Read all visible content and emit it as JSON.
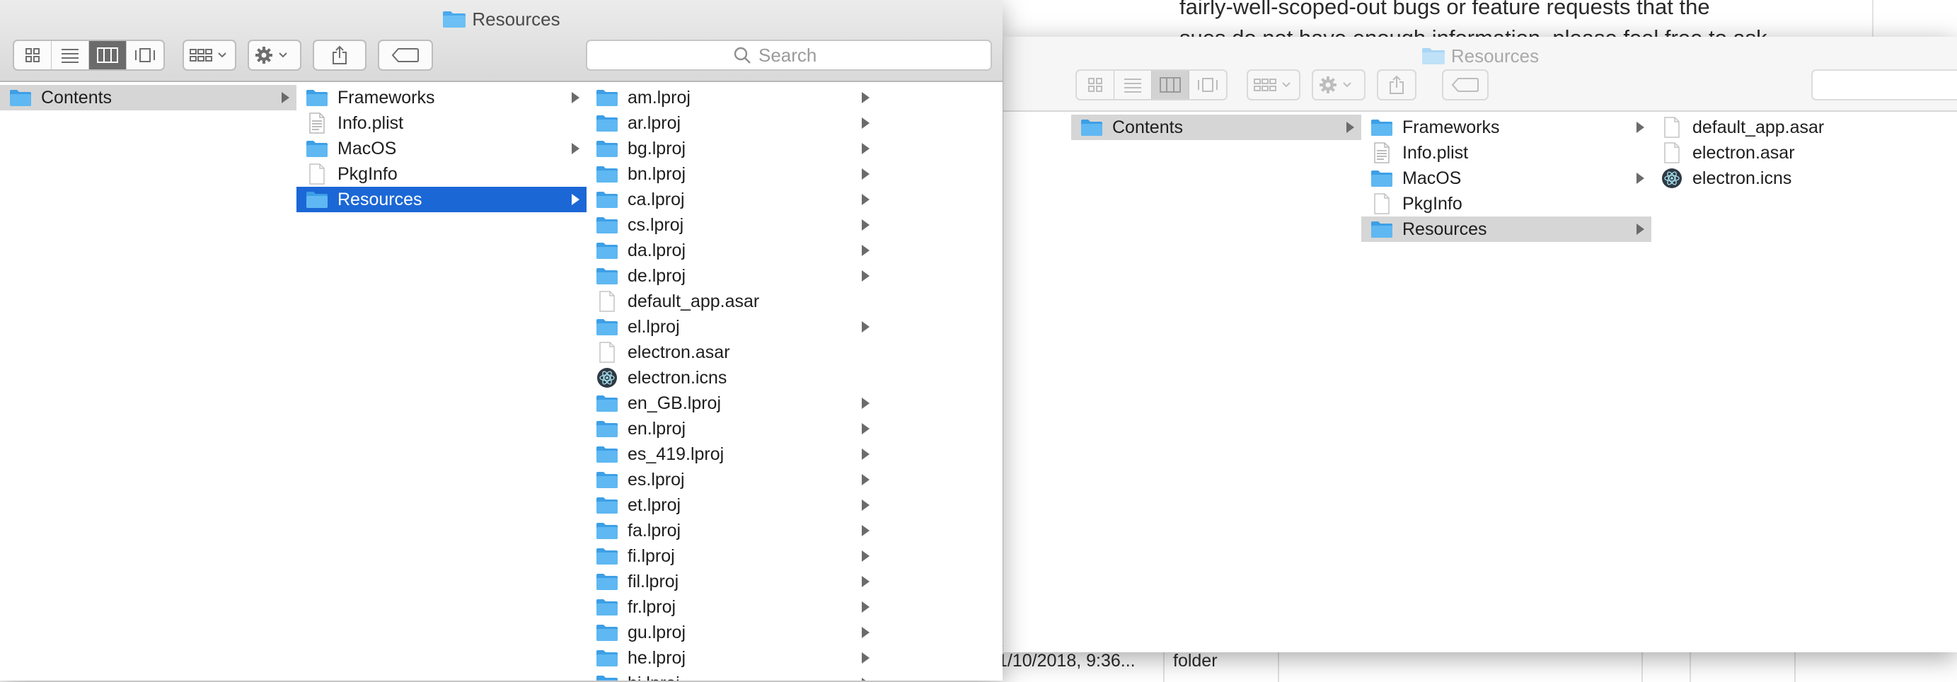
{
  "background_document": {
    "line1": "fairly-well-scoped-out bugs or feature requests that the",
    "line2": "sues do not have enough information, please feel free to ask",
    "table_date": "1/10/2018, 9:36...",
    "table_kind": "folder"
  },
  "front_window": {
    "title": "Resources",
    "search": {
      "placeholder": "Search"
    },
    "columns": [
      {
        "items": [
          {
            "label": "Contents",
            "kind": "folder",
            "arrow": true,
            "state": "gray"
          }
        ]
      },
      {
        "items": [
          {
            "label": "Frameworks",
            "kind": "folder",
            "arrow": true
          },
          {
            "label": "Info.plist",
            "kind": "plist",
            "arrow": false
          },
          {
            "label": "MacOS",
            "kind": "folder",
            "arrow": true
          },
          {
            "label": "PkgInfo",
            "kind": "file",
            "arrow": false
          },
          {
            "label": "Resources",
            "kind": "folder",
            "arrow": true,
            "state": "selected"
          }
        ]
      },
      {
        "items": [
          {
            "label": "am.lproj",
            "kind": "folder",
            "arrow": true
          },
          {
            "label": "ar.lproj",
            "kind": "folder",
            "arrow": true
          },
          {
            "label": "bg.lproj",
            "kind": "folder",
            "arrow": true
          },
          {
            "label": "bn.lproj",
            "kind": "folder",
            "arrow": true
          },
          {
            "label": "ca.lproj",
            "kind": "folder",
            "arrow": true
          },
          {
            "label": "cs.lproj",
            "kind": "folder",
            "arrow": true
          },
          {
            "label": "da.lproj",
            "kind": "folder",
            "arrow": true
          },
          {
            "label": "de.lproj",
            "kind": "folder",
            "arrow": true
          },
          {
            "label": "default_app.asar",
            "kind": "file",
            "arrow": false
          },
          {
            "label": "el.lproj",
            "kind": "folder",
            "arrow": true
          },
          {
            "label": "electron.asar",
            "kind": "file",
            "arrow": false
          },
          {
            "label": "electron.icns",
            "kind": "electron",
            "arrow": false
          },
          {
            "label": "en_GB.lproj",
            "kind": "folder",
            "arrow": true
          },
          {
            "label": "en.lproj",
            "kind": "folder",
            "arrow": true
          },
          {
            "label": "es_419.lproj",
            "kind": "folder",
            "arrow": true
          },
          {
            "label": "es.lproj",
            "kind": "folder",
            "arrow": true
          },
          {
            "label": "et.lproj",
            "kind": "folder",
            "arrow": true
          },
          {
            "label": "fa.lproj",
            "kind": "folder",
            "arrow": true
          },
          {
            "label": "fi.lproj",
            "kind": "folder",
            "arrow": true
          },
          {
            "label": "fil.lproj",
            "kind": "folder",
            "arrow": true
          },
          {
            "label": "fr.lproj",
            "kind": "folder",
            "arrow": true
          },
          {
            "label": "gu.lproj",
            "kind": "folder",
            "arrow": true
          },
          {
            "label": "he.lproj",
            "kind": "folder",
            "arrow": true
          },
          {
            "label": "hi.lproj",
            "kind": "folder",
            "arrow": true
          }
        ]
      },
      {
        "items": []
      }
    ]
  },
  "back_window": {
    "title": "Resources",
    "columns": [
      {
        "items": []
      },
      {
        "items": [
          {
            "label": "Contents",
            "kind": "folder",
            "arrow": true,
            "state": "gray"
          }
        ]
      },
      {
        "items": [
          {
            "label": "Frameworks",
            "kind": "folder",
            "arrow": true
          },
          {
            "label": "Info.plist",
            "kind": "plist",
            "arrow": false
          },
          {
            "label": "MacOS",
            "kind": "folder",
            "arrow": true
          },
          {
            "label": "PkgInfo",
            "kind": "file",
            "arrow": false
          },
          {
            "label": "Resources",
            "kind": "folder",
            "arrow": true,
            "state": "gray"
          }
        ]
      },
      {
        "items": [
          {
            "label": "default_app.asar",
            "kind": "file",
            "arrow": false
          },
          {
            "label": "electron.asar",
            "kind": "file",
            "arrow": false
          },
          {
            "label": "electron.icns",
            "kind": "electron",
            "arrow": false
          }
        ]
      }
    ]
  },
  "colors": {
    "selection_blue": "#1b67d6",
    "folder_blue": "#5fb8f2",
    "gray_selection": "#d6d6d6"
  }
}
